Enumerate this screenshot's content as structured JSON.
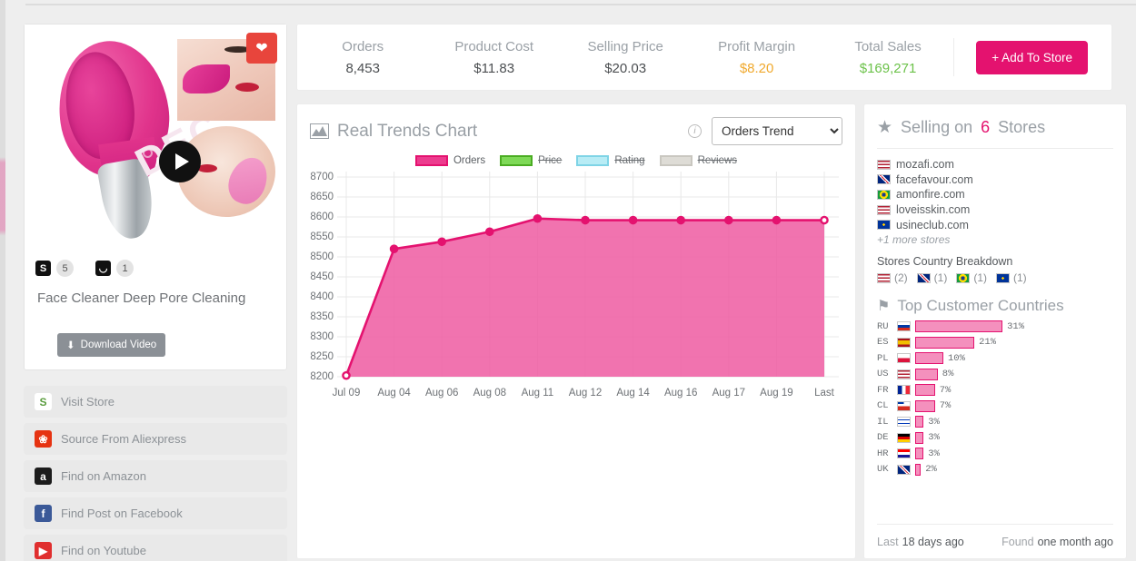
{
  "product": {
    "title": "Face Cleaner Deep Pore Cleaning",
    "favorite_icon": "heart-icon",
    "play_icon": "play-icon",
    "download_label": "Download Video",
    "download_icon": "download-icon",
    "platforms": [
      {
        "icon": "shopify-icon",
        "glyph": "S",
        "count": "5"
      },
      {
        "icon": "shopping-bag-icon",
        "glyph": "◡",
        "count": "1"
      }
    ]
  },
  "actions": [
    {
      "label": "Visit Store",
      "icon": "shopify-icon",
      "glyph": "S",
      "color": "#5a9c3e",
      "bg": "#ffffff"
    },
    {
      "label": "Source From Aliexpress",
      "icon": "aliexpress-icon",
      "glyph": "❀",
      "color": "#ffffff",
      "bg": "#e63312"
    },
    {
      "label": "Find on Amazon",
      "icon": "amazon-icon",
      "glyph": "a",
      "color": "#ffffff",
      "bg": "#1c1c1c"
    },
    {
      "label": "Find Post on Facebook",
      "icon": "facebook-icon",
      "glyph": "f",
      "color": "#ffffff",
      "bg": "#3b5998"
    },
    {
      "label": "Find on Youtube",
      "icon": "youtube-icon",
      "glyph": "▶",
      "color": "#ffffff",
      "bg": "#e02f2f"
    }
  ],
  "stats": {
    "items": [
      {
        "label": "Orders",
        "value": "8,453",
        "tone": ""
      },
      {
        "label": "Product Cost",
        "value": "$11.83",
        "tone": ""
      },
      {
        "label": "Selling Price",
        "value": "$20.03",
        "tone": ""
      },
      {
        "label": "Profit Margin",
        "value": "$8.20",
        "tone": "amber"
      },
      {
        "label": "Total Sales",
        "value": "$169,271",
        "tone": "green"
      }
    ],
    "add_to_store": "+ Add To Store",
    "accent_pink": "#e4126f",
    "amber": "#f0a92e",
    "green": "#6cc24a"
  },
  "chart": {
    "title": "Real Trends Chart",
    "title_icon": "area-chart-icon",
    "info_icon": "info-icon",
    "selected_trend": "Orders Trend",
    "trend_options": [
      "Orders Trend"
    ],
    "legend": [
      {
        "label": "Orders",
        "color": "#ec3c8e",
        "border": "#e4126f",
        "active": true
      },
      {
        "label": "Price",
        "color": "#7ed957",
        "border": "#4aac22",
        "active": false
      },
      {
        "label": "Rating",
        "color": "#b8ecf5",
        "border": "#7fd4e6",
        "active": false
      },
      {
        "label": "Reviews",
        "color": "#dedcd6",
        "border": "#c9c7c0",
        "active": false
      }
    ]
  },
  "chart_data": {
    "type": "area",
    "title": "Real Trends Chart",
    "series_name": "Orders Trend",
    "xlabel": "",
    "ylabel": "",
    "ylim": [
      8200,
      8700
    ],
    "yticks": [
      8200,
      8250,
      8300,
      8350,
      8400,
      8450,
      8500,
      8550,
      8600,
      8650,
      8700
    ],
    "grid": true,
    "legend_position": "top-center",
    "categories": [
      "Jul 09",
      "Aug 04",
      "Aug 06",
      "Aug 08",
      "Aug 11",
      "Aug 12",
      "Aug 14",
      "Aug 16",
      "Aug 17",
      "Aug 19",
      "Last"
    ],
    "values": [
      8203,
      8520,
      8538,
      8563,
      8596,
      8592,
      8592,
      8592,
      8592,
      8592,
      8592
    ],
    "line_color": "#e4126f",
    "fill_color": "#ef5ba1"
  },
  "stores": {
    "title_prefix": "Selling on",
    "count": "6",
    "title_suffix": "Stores",
    "title_icon": "star-icon",
    "list": [
      {
        "domain": "mozafi.com",
        "flag": "us"
      },
      {
        "domain": "facefavour.com",
        "flag": "gb"
      },
      {
        "domain": "amonfire.com",
        "flag": "br"
      },
      {
        "domain": "loveisskin.com",
        "flag": "us"
      },
      {
        "domain": "usineclub.com",
        "flag": "eu"
      }
    ],
    "more": "+1 more stores",
    "breakdown_label": "Stores Country Breakdown",
    "breakdown": [
      {
        "flag": "us",
        "count": "(2)"
      },
      {
        "flag": "gb",
        "count": "(1)"
      },
      {
        "flag": "br",
        "count": "(1)"
      },
      {
        "flag": "eu",
        "count": "(1)"
      }
    ]
  },
  "countries": {
    "title": "Top Customer Countries",
    "title_icon": "flag-icon",
    "rows": [
      {
        "code": "RU",
        "flag": "ru",
        "pct": "31%",
        "value": 31
      },
      {
        "code": "ES",
        "flag": "es",
        "pct": "21%",
        "value": 21
      },
      {
        "code": "PL",
        "flag": "pl",
        "pct": "10%",
        "value": 10
      },
      {
        "code": "US",
        "flag": "us",
        "pct": "8%",
        "value": 8
      },
      {
        "code": "FR",
        "flag": "fr",
        "pct": "7%",
        "value": 7
      },
      {
        "code": "CL",
        "flag": "cl",
        "pct": "7%",
        "value": 7
      },
      {
        "code": "IL",
        "flag": "il",
        "pct": "3%",
        "value": 3
      },
      {
        "code": "DE",
        "flag": "de",
        "pct": "3%",
        "value": 3
      },
      {
        "code": "HR",
        "flag": "hr",
        "pct": "3%",
        "value": 3
      },
      {
        "code": "UK",
        "flag": "gb",
        "pct": "2%",
        "value": 2
      }
    ]
  },
  "footer": {
    "last_key": "Last",
    "last_value": "18 days ago",
    "found_key": "Found",
    "found_value": "one month ago"
  }
}
